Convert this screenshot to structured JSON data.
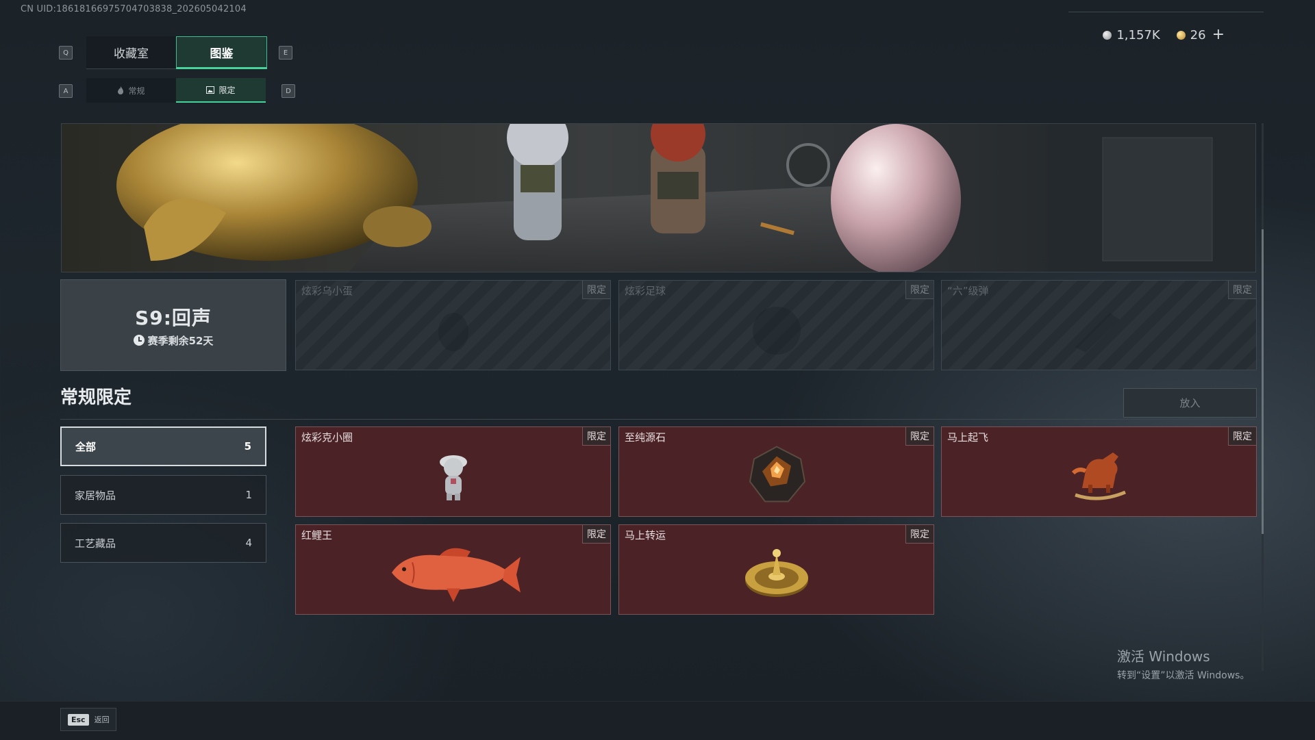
{
  "header": {
    "uid": "CN UID:18618166975704703838_202605042104",
    "currency": [
      {
        "icon": "silver-coin-icon",
        "value": "1,157K"
      },
      {
        "icon": "gold-coin-icon",
        "value": "26"
      }
    ],
    "add_label": "+"
  },
  "keys": {
    "tab_prev": "Q",
    "tab_next": "E",
    "sub_prev": "A",
    "sub_next": "D"
  },
  "tabs": [
    {
      "label": "收藏室",
      "active": false
    },
    {
      "label": "图鉴",
      "active": true
    }
  ],
  "subtabs": [
    {
      "label": "常规",
      "icon": "flame-icon",
      "active": false
    },
    {
      "label": "限定",
      "icon": "image-icon",
      "active": true
    }
  ],
  "season": {
    "title": "S9:回声",
    "remaining": "赛季剩余52天"
  },
  "season_slots": [
    {
      "name": "炫彩乌小蛋",
      "tag": "限定"
    },
    {
      "name": "炫彩足球",
      "tag": "限定"
    },
    {
      "name": "“六”级弹",
      "tag": "限定"
    }
  ],
  "section": {
    "title": "常规限定",
    "put_button": "放入"
  },
  "categories": [
    {
      "label": "全部",
      "count": "5",
      "active": true
    },
    {
      "label": "家居物品",
      "count": "1",
      "active": false
    },
    {
      "label": "工艺藏品",
      "count": "4",
      "active": false
    }
  ],
  "items": [
    {
      "name": "炫彩克小圈",
      "tag": "限定",
      "icon": "figurine-icon"
    },
    {
      "name": "至纯源石",
      "tag": "限定",
      "icon": "gem-stone-icon"
    },
    {
      "name": "马上起飞",
      "tag": "限定",
      "icon": "rocking-horse-icon"
    },
    {
      "name": "红鲤王",
      "tag": "限定",
      "icon": "carp-fish-icon"
    },
    {
      "name": "马上转运",
      "tag": "限定",
      "icon": "golden-turntable-icon"
    }
  ],
  "watermark": {
    "line1": "激活 Windows",
    "line2": "转到“设置”以激活 Windows。"
  },
  "footer": {
    "esc_key": "Esc",
    "esc_label": "返回"
  }
}
